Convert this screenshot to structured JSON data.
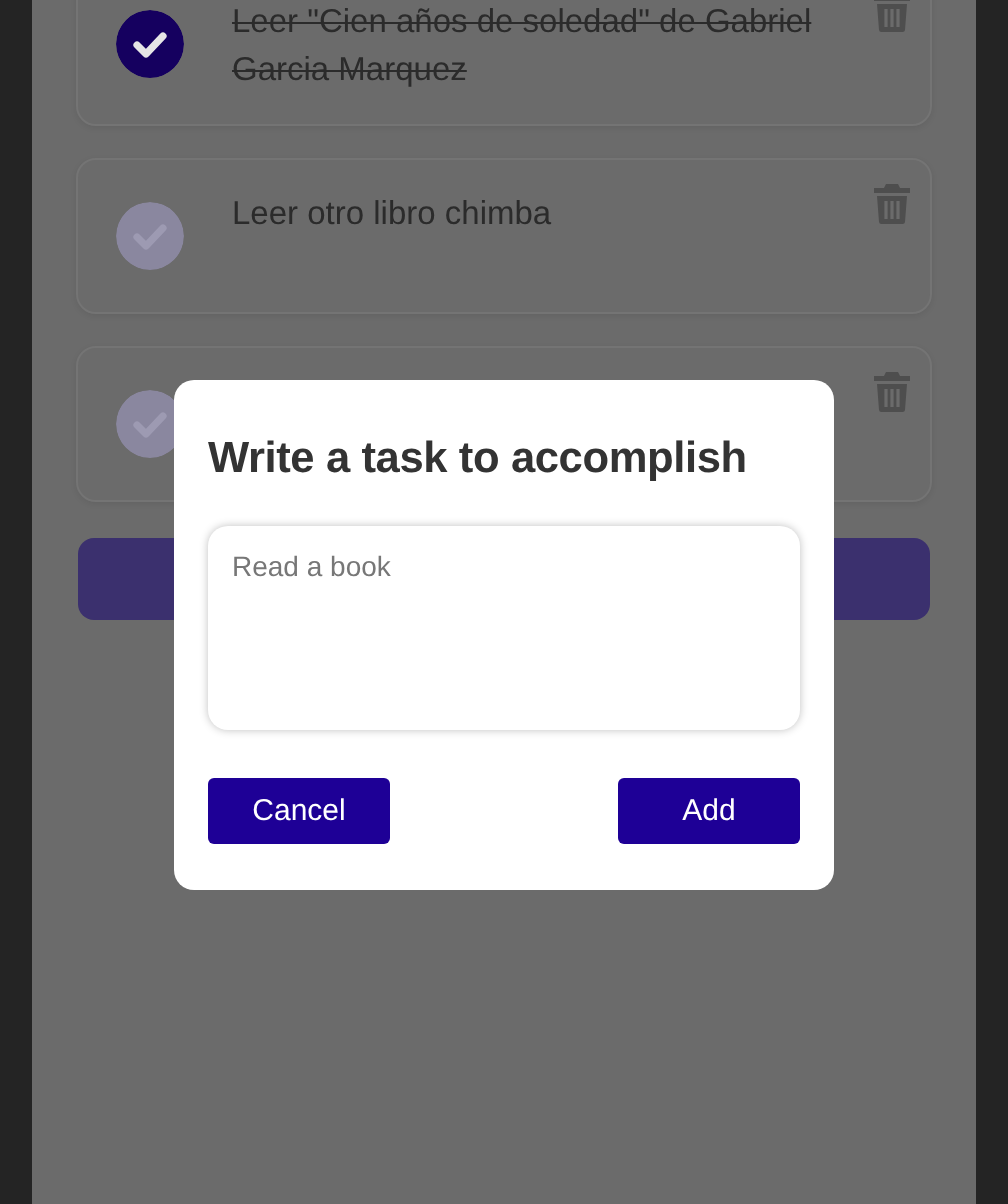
{
  "todos": [
    {
      "text": "Leer \"Cien años de soledad\" de Gabriel Garcia Marquez",
      "completed": true
    },
    {
      "text": "Leer otro libro chimba",
      "completed": false
    },
    {
      "completed": false
    }
  ],
  "modal": {
    "title": "Write a task to accomplish",
    "textarea": {
      "placeholder": "Read a book"
    },
    "buttons": [
      {
        "label": "Cancel"
      },
      {
        "label": "Add"
      }
    ]
  }
}
